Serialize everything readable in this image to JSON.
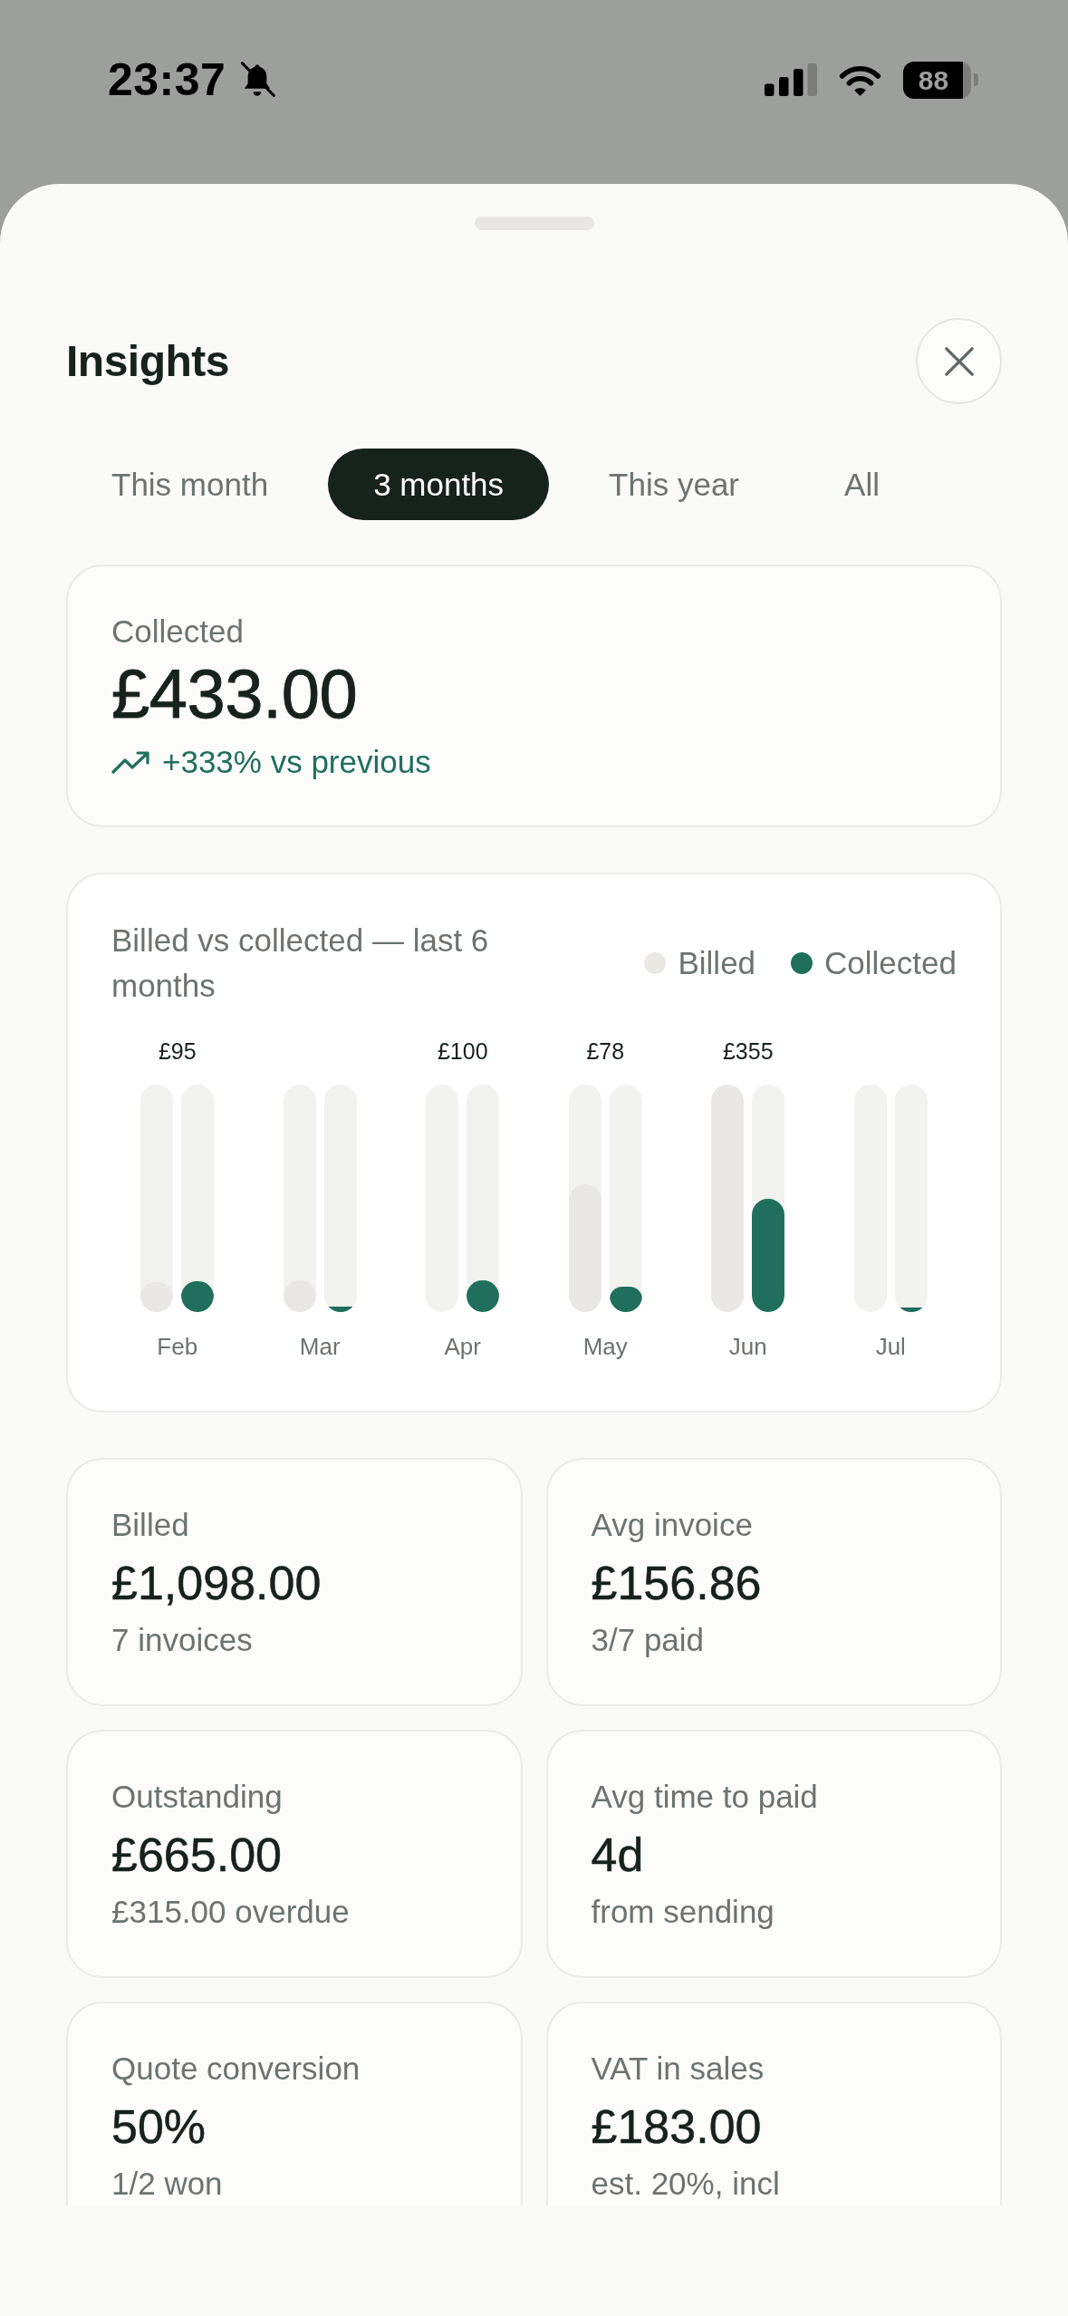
{
  "status_bar": {
    "time": "23:37",
    "battery": "88"
  },
  "sheet": {
    "title": "Insights"
  },
  "tabs": [
    {
      "label": "This month",
      "selected": false
    },
    {
      "label": "3 months",
      "selected": true
    },
    {
      "label": "This year",
      "selected": false
    },
    {
      "label": "All",
      "selected": false
    }
  ],
  "summary": {
    "label": "Collected",
    "value": "£433.00",
    "trend": "+333% vs previous"
  },
  "chart": {
    "title": "Billed vs collected — last 6 months",
    "legend": [
      {
        "label": "Billed",
        "color": "#e9e8e4"
      },
      {
        "label": "Collected",
        "color": "#1f6f5c"
      }
    ],
    "months": [
      {
        "label": "Feb",
        "amount": "£95",
        "bars": [
          {
            "level": 0.13
          },
          {
            "level": 0.135
          }
        ]
      },
      {
        "label": "Mar",
        "bars": [
          {
            "level": 0.14
          },
          {
            "level": 0.024
          }
        ]
      },
      {
        "label": "Apr",
        "amount": "£100",
        "bars": [
          {
            "level": 0
          },
          {
            "level": 0.14
          }
        ]
      },
      {
        "label": "May",
        "amount": "£78",
        "bars": [
          {
            "level": 0.56
          },
          {
            "level": 0.11
          }
        ]
      },
      {
        "label": "Jun",
        "amount": "£355",
        "bars": [
          {
            "level": 1
          },
          {
            "level": 0.5
          }
        ]
      },
      {
        "label": "Jul",
        "bars": [
          {
            "level": 0
          },
          {
            "level": 0.02
          }
        ]
      }
    ]
  },
  "stats": [
    {
      "label": "Billed",
      "value": "£1,098.00",
      "note": "7 invoices"
    },
    {
      "label": "Avg invoice",
      "value": "£156.86",
      "note": "3/7 paid"
    },
    {
      "label": "Outstanding",
      "value": "£665.00",
      "note": "£315.00 overdue"
    },
    {
      "label": "Avg time to paid",
      "value": "4d",
      "note": "from sending"
    },
    {
      "label": "Quote conversion",
      "value": "50%",
      "note": "1/2 won"
    },
    {
      "label": "VAT in sales",
      "value": "£183.00",
      "note": "est. 20%, incl"
    }
  ]
}
